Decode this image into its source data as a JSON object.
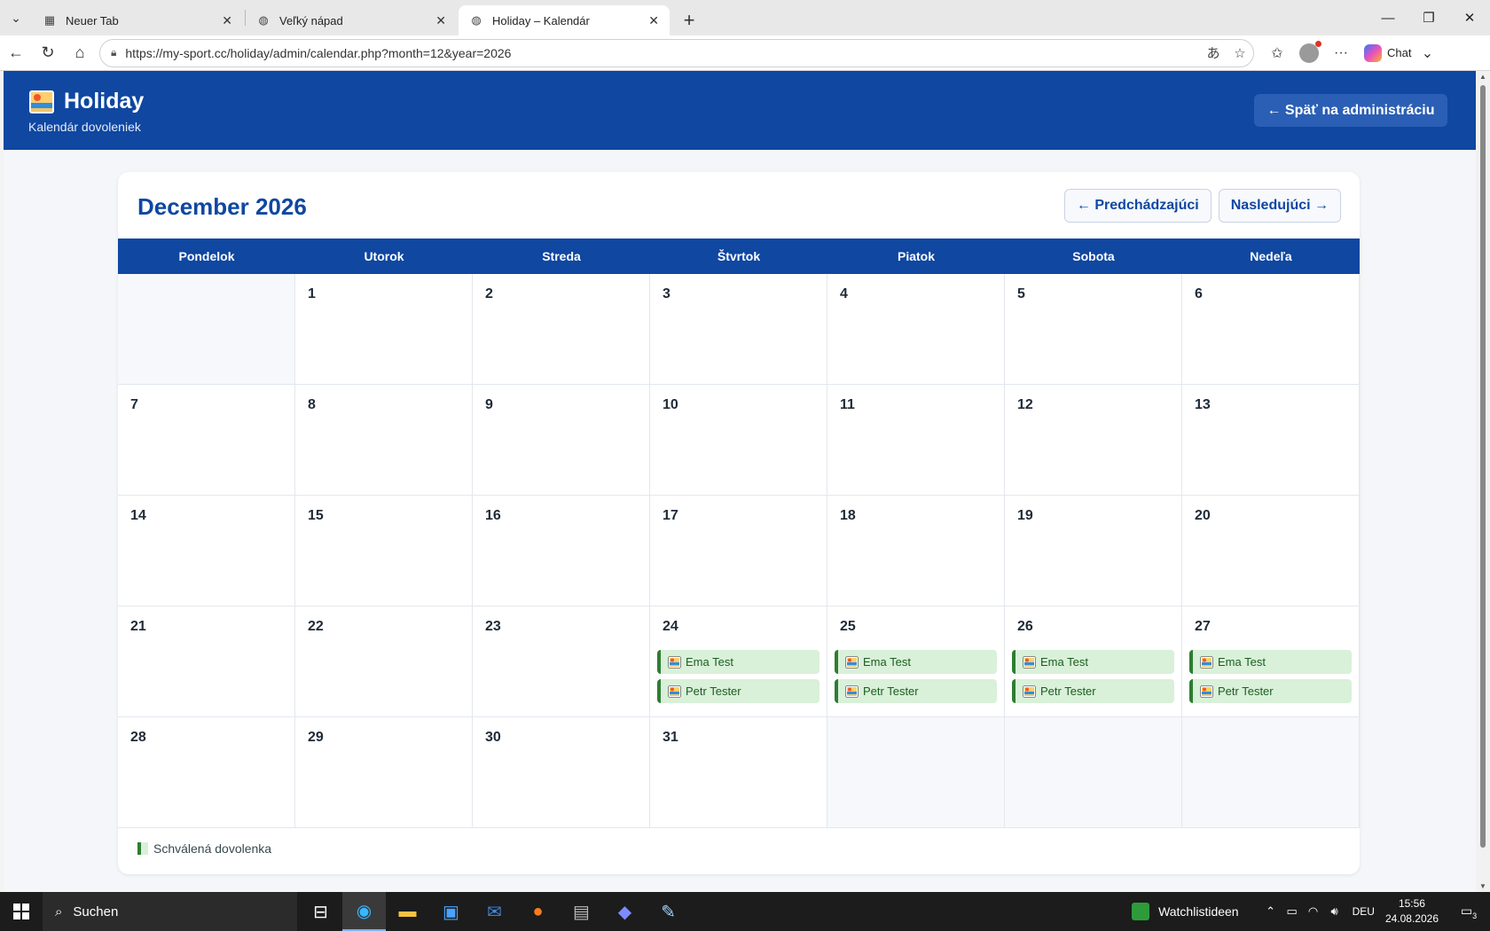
{
  "browser": {
    "tabs": [
      {
        "title": "Neuer Tab",
        "icon": "newtab-icon",
        "active": false
      },
      {
        "title": "Veľký nápad",
        "icon": "globe-icon",
        "active": false
      },
      {
        "title": "Holiday – Kalendár",
        "icon": "globe-icon",
        "active": true
      }
    ],
    "url": "https://my-sport.cc/holiday/admin/calendar.php?month=12&year=2026",
    "chat_label": "Chat"
  },
  "app": {
    "title": "Holiday",
    "subtitle": "Kalendár dovoleniek",
    "back_label": "← Späť na administráciu",
    "brand_color": "#0f47a1"
  },
  "calendar": {
    "month_title": "December 2026",
    "prev_label": "← Predchádzajúci",
    "next_label": "Nasledujúci →",
    "weekdays": [
      "Pondelok",
      "Utorok",
      "Streda",
      "Štvrtok",
      "Piatok",
      "Sobota",
      "Nedeľa"
    ],
    "cells": [
      {
        "day": "",
        "events": []
      },
      {
        "day": "1",
        "events": []
      },
      {
        "day": "2",
        "events": []
      },
      {
        "day": "3",
        "events": []
      },
      {
        "day": "4",
        "events": []
      },
      {
        "day": "5",
        "events": []
      },
      {
        "day": "6",
        "events": []
      },
      {
        "day": "7",
        "events": []
      },
      {
        "day": "8",
        "events": []
      },
      {
        "day": "9",
        "events": []
      },
      {
        "day": "10",
        "events": []
      },
      {
        "day": "11",
        "events": []
      },
      {
        "day": "12",
        "events": []
      },
      {
        "day": "13",
        "events": []
      },
      {
        "day": "14",
        "events": []
      },
      {
        "day": "15",
        "events": []
      },
      {
        "day": "16",
        "events": []
      },
      {
        "day": "17",
        "events": []
      },
      {
        "day": "18",
        "events": []
      },
      {
        "day": "19",
        "events": []
      },
      {
        "day": "20",
        "events": []
      },
      {
        "day": "21",
        "events": []
      },
      {
        "day": "22",
        "events": []
      },
      {
        "day": "23",
        "events": []
      },
      {
        "day": "24",
        "events": [
          "Ema Test",
          "Petr Tester"
        ]
      },
      {
        "day": "25",
        "events": [
          "Ema Test",
          "Petr Tester"
        ]
      },
      {
        "day": "26",
        "events": [
          "Ema Test",
          "Petr Tester"
        ]
      },
      {
        "day": "27",
        "events": [
          "Ema Test",
          "Petr Tester"
        ]
      },
      {
        "day": "28",
        "events": []
      },
      {
        "day": "29",
        "events": []
      },
      {
        "day": "30",
        "events": []
      },
      {
        "day": "31",
        "events": []
      },
      {
        "day": "",
        "events": []
      },
      {
        "day": "",
        "events": []
      },
      {
        "day": "",
        "events": []
      }
    ],
    "legend_label": "Schválená dovolenka",
    "approved_color": "#2e7d32"
  },
  "taskbar": {
    "search_label": "Suchen",
    "watchlist_label": "Watchlistideen",
    "lang": "DEU",
    "time": "15:56",
    "date": "24.08.2026",
    "notifications": "3"
  }
}
